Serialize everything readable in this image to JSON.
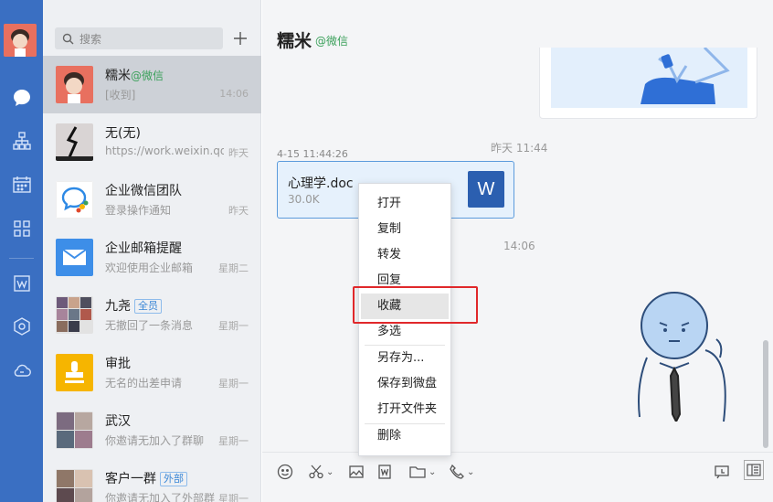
{
  "search": {
    "placeholder": "搜索"
  },
  "conversations": [
    {
      "name": "糯米",
      "tag": "@微信",
      "preview": "[收到]",
      "time": "14:06"
    },
    {
      "name": "无(无)",
      "preview": "https://work.weixin.qq.com",
      "time": "昨天"
    },
    {
      "name": "企业微信团队",
      "preview": "登录操作通知",
      "time": "昨天"
    },
    {
      "name": "企业邮箱提醒",
      "preview": "欢迎使用企业邮箱",
      "time": "星期二"
    },
    {
      "name": "九尧",
      "badge": "全员",
      "preview": "无撤回了一条消息",
      "time": "星期一"
    },
    {
      "name": "审批",
      "preview": "无名的出差申请",
      "time": "星期一"
    },
    {
      "name": "武汉",
      "preview": "你邀请无加入了群聊",
      "time": "星期一"
    },
    {
      "name": "客户一群",
      "badge": "外部",
      "preview": "你邀请无加入了外部群",
      "time": "星期一"
    }
  ],
  "chat": {
    "title": "糯米",
    "subtitle": "@微信",
    "time_yesterday": "昨天 11:44",
    "file_date": "4-15 11:44:26",
    "time_today": "14:06",
    "file": {
      "name": "心理学.doc",
      "size": "30.0K",
      "icon_letter": "W"
    }
  },
  "context_menu": {
    "items": [
      "打开",
      "复制",
      "转发",
      "回复",
      "收藏",
      "多选",
      "另存为...",
      "保存到微盘",
      "打开文件夹",
      "删除"
    ],
    "highlighted": "收藏"
  },
  "colors": {
    "rail": "#3a6fc2",
    "highlight_box": "#e0282b",
    "file_icon": "#2b5fb0"
  }
}
